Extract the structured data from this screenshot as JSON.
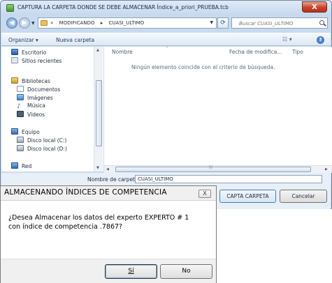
{
  "folder_dialog": {
    "title": "CAPTURA LA CARPETA DONDE SE DEBE ALMACENAR Índice_a_priori_PRUEBA.tcb",
    "close_symbol": "X",
    "address": {
      "overflow": "«",
      "segments": [
        "MODIFICANDO",
        "▸",
        "CUASI_ULTIMO"
      ]
    },
    "search_placeholder": "Buscar CUASI_ULTIMO",
    "toolbar": {
      "organize": "Organizar ▾",
      "new_folder": "Nueva carpeta",
      "views": "☷ ▾",
      "help": "?"
    },
    "nav_items": [
      {
        "label": "Escritorio"
      },
      {
        "label": "Sitios recientes"
      },
      {
        "label": "Bibliotecas"
      },
      {
        "label": "Documentos"
      },
      {
        "label": "Imágenes"
      },
      {
        "label": "Música"
      },
      {
        "label": "Vídeos"
      },
      {
        "label": "Equipo"
      },
      {
        "label": "Disco local (C:)"
      },
      {
        "label": "Disco local (D:)"
      },
      {
        "label": "Red"
      }
    ],
    "columns": {
      "name": "Nombre",
      "date": "Fecha de modifica...",
      "type": "Tipo"
    },
    "empty_message": "Ningún elemento coincide con el criterio de búsqueda.",
    "folder_name_label": "Nombre de carpeta:",
    "folder_name_value": "CUASI_ULTIMO",
    "select_button": "CAPTA CARPETA",
    "cancel_button": "Cancelar"
  },
  "message_box": {
    "title": "ALMACENANDO ÍNDICES DE COMPETENCIA",
    "close_symbol": "X",
    "line1": "¿Desea Almacenar los datos del experto  EXPERTO # 1",
    "line2": "con índice de competencia  .7867?",
    "yes_button": "Sí",
    "no_button": "No"
  }
}
